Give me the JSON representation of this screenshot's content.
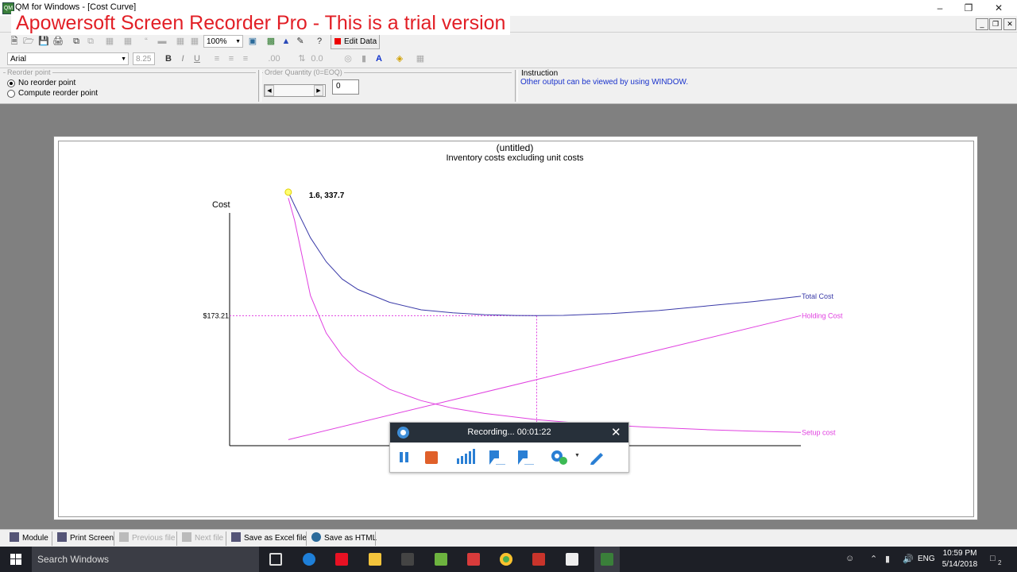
{
  "window": {
    "title": "QM for Windows - [Cost Curve]",
    "watermark": "Apowersoft Screen Recorder Pro - This is a trial version",
    "buttons": {
      "minimize": "–",
      "restore": "❐",
      "close": "✕"
    },
    "mdi_buttons": {
      "minimize": "_",
      "restore": "❐",
      "close": "✕"
    }
  },
  "toolbar": {
    "zoom_value": "100%",
    "edit_data_label": "Edit Data",
    "font_name": "Arial",
    "font_size": "8.25",
    "bold_label": "B",
    "italic_label": "I",
    "underline_label": "U",
    "decimal_format": ".00"
  },
  "options": {
    "reorder_group_label": "Reorder point",
    "reorder_options": [
      "No reorder point",
      "Compute reorder point"
    ],
    "order_qty_label": "Order Quantity (0=EOQ)",
    "order_qty_value": "0",
    "instruction_label": "Instruction",
    "instruction_text": "Other output can be viewed by using WINDOW."
  },
  "chart_data": {
    "type": "line",
    "title": "(untitled)",
    "subtitle": "Inventory costs excluding unit costs",
    "ylabel": "Cost",
    "hover_label": "1.6, 337.7",
    "ref_value_label": "$173.21",
    "xlim": [
      0,
      34
    ],
    "ylim": [
      0,
      400
    ],
    "eoq_x": 17.3,
    "eoq_y": 173.21,
    "series": [
      {
        "name": "Total Cost",
        "color": "#3a3aa8",
        "x": [
          1.6,
          2,
          3,
          4,
          5,
          6,
          8,
          10,
          12,
          14,
          16,
          17.3,
          19,
          22,
          25,
          28,
          31,
          34
        ],
        "y": [
          337.7,
          320,
          277,
          245,
          222,
          208,
          191,
          181,
          177,
          174.5,
          173.4,
          173.21,
          173.5,
          176,
          180,
          186,
          192,
          199
        ]
      },
      {
        "name": "Holding Cost",
        "color": "#e040e0",
        "x": [
          1.6,
          34
        ],
        "y": [
          8,
          173.21
        ]
      },
      {
        "name": "Setup cost",
        "color": "#e040e0",
        "x": [
          1.6,
          2,
          3,
          4,
          5,
          6,
          8,
          10,
          12,
          14,
          17.3,
          20,
          24,
          28,
          31,
          34
        ],
        "y": [
          330,
          300,
          200,
          150,
          120,
          100,
          75,
          60,
          50,
          43,
          34.7,
          30,
          25,
          21.4,
          19.4,
          17.7
        ]
      }
    ]
  },
  "recorder": {
    "status": "Recording... 00:01:22"
  },
  "statusbar": {
    "buttons": [
      "Module",
      "Print Screen",
      "Previous file",
      "Next file",
      "Save as Excel file",
      "Save as HTML"
    ]
  },
  "taskbar": {
    "search_placeholder": "Search Windows",
    "lang": "ENG",
    "time": "10:59 PM",
    "date": "5/14/2018",
    "notification_count": "2"
  }
}
